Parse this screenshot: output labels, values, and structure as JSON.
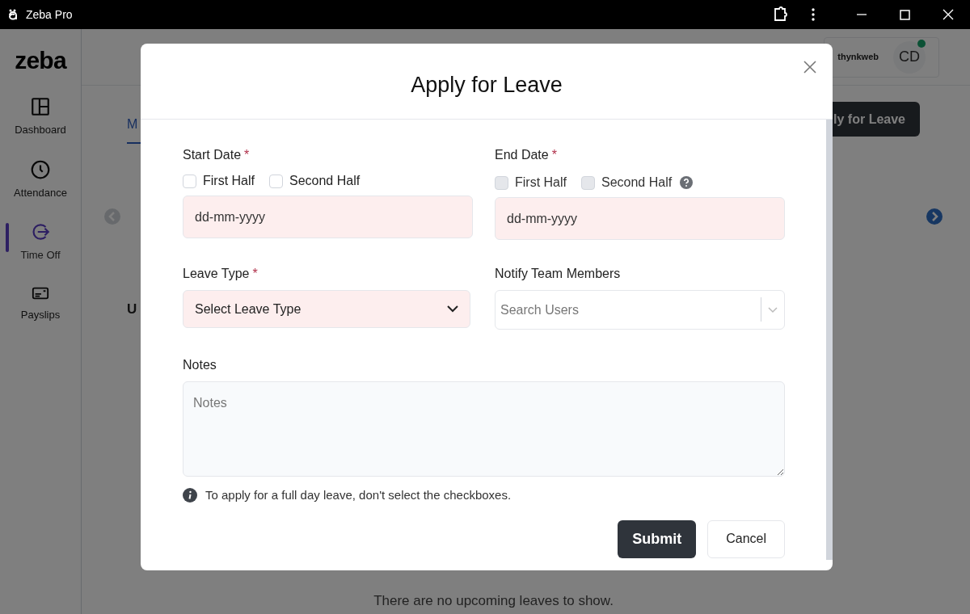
{
  "window": {
    "title": "Zeba Pro"
  },
  "sidebar": {
    "logo": "zeba",
    "items": [
      {
        "label": "Dashboard",
        "kind": "dashboard",
        "selected": false
      },
      {
        "label": "Attendance",
        "kind": "clock",
        "selected": false
      },
      {
        "label": "Time Off",
        "kind": "exit",
        "selected": true
      },
      {
        "label": "Payslips",
        "kind": "card",
        "selected": false
      }
    ]
  },
  "header": {
    "company_logo": "thynkweb",
    "avatar": "CD",
    "online": true
  },
  "background": {
    "apply_button": "ly for Leave",
    "tab_fragment": "M",
    "section_fragment": "U",
    "empty_text": "There are no upcoming leaves to show."
  },
  "dialog": {
    "title": "Apply for Leave",
    "start_date": {
      "label": "Start Date",
      "required_mark": "*",
      "first_half": {
        "label": "First Half",
        "checked": false,
        "disabled": false
      },
      "second_half": {
        "label": "Second Half",
        "checked": false,
        "disabled": false
      },
      "placeholder": "dd-mm-yyyy"
    },
    "end_date": {
      "label": "End Date",
      "required_mark": "*",
      "first_half": {
        "label": "First Half",
        "checked": false,
        "disabled": true
      },
      "second_half": {
        "label": "Second Half",
        "checked": false,
        "disabled": true
      },
      "placeholder": "dd-mm-yyyy"
    },
    "leave_type": {
      "label": "Leave Type",
      "required_mark": "*",
      "value": "Select Leave Type"
    },
    "notify": {
      "label": "Notify Team Members",
      "placeholder": "Search Users"
    },
    "notes": {
      "label": "Notes",
      "placeholder": "Notes"
    },
    "hint": "To apply for a full day leave, don't select the checkboxes.",
    "buttons": [
      "Submit",
      "Cancel"
    ]
  }
}
